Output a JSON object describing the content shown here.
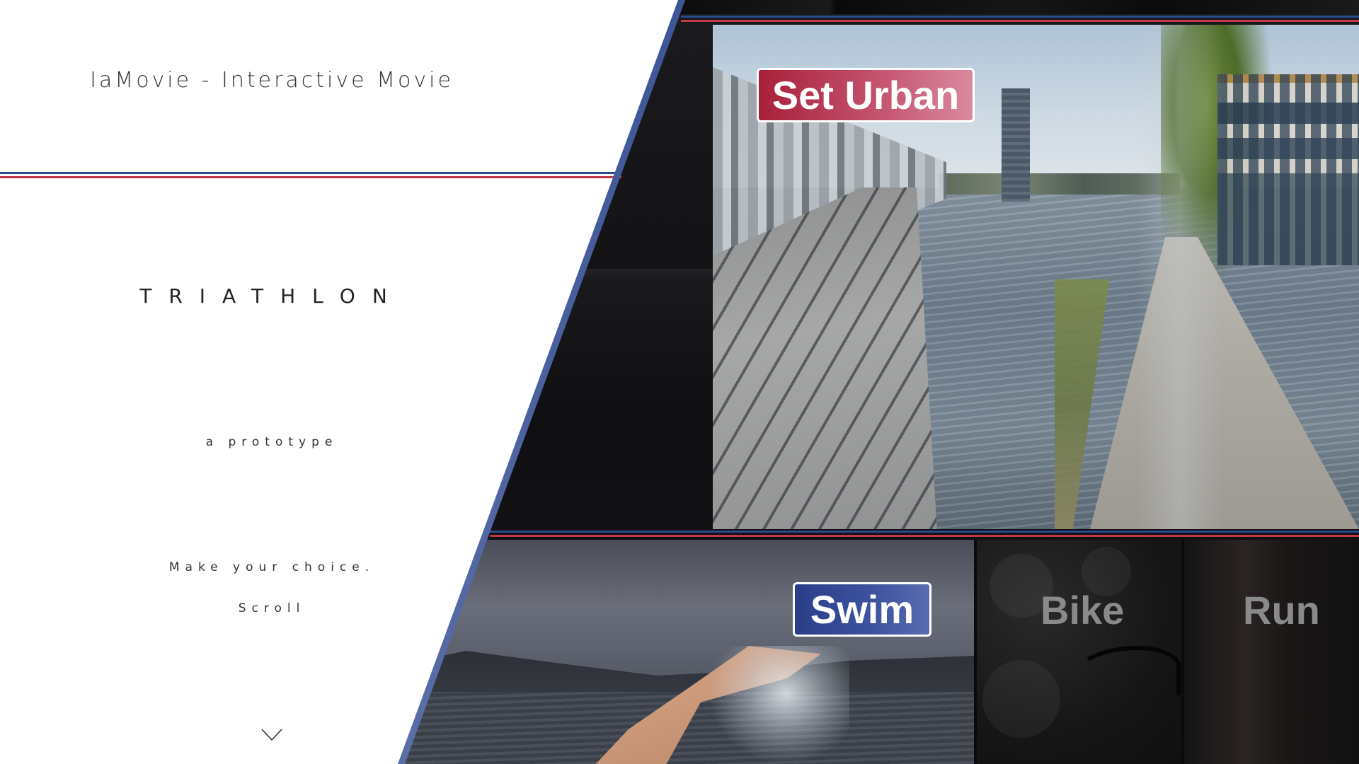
{
  "header": {
    "title": "IaMovie - Interactive Movie"
  },
  "hero": {
    "heading": "TRIATHLON",
    "tagline": "a prototype",
    "instruction": "Make your choice.",
    "scroll_hint": "Scroll"
  },
  "scenes": {
    "urban_label": "Set Urban",
    "swim_label": "Swim",
    "bike_label": "Bike",
    "run_label": "Run"
  },
  "colors": {
    "accent_red": "#c23a4a",
    "accent_blue": "#2c4a90",
    "urban_tag": "#b83350",
    "swim_tag": "#34489a"
  },
  "icons": {
    "scroll": "chevron-down-icon"
  }
}
